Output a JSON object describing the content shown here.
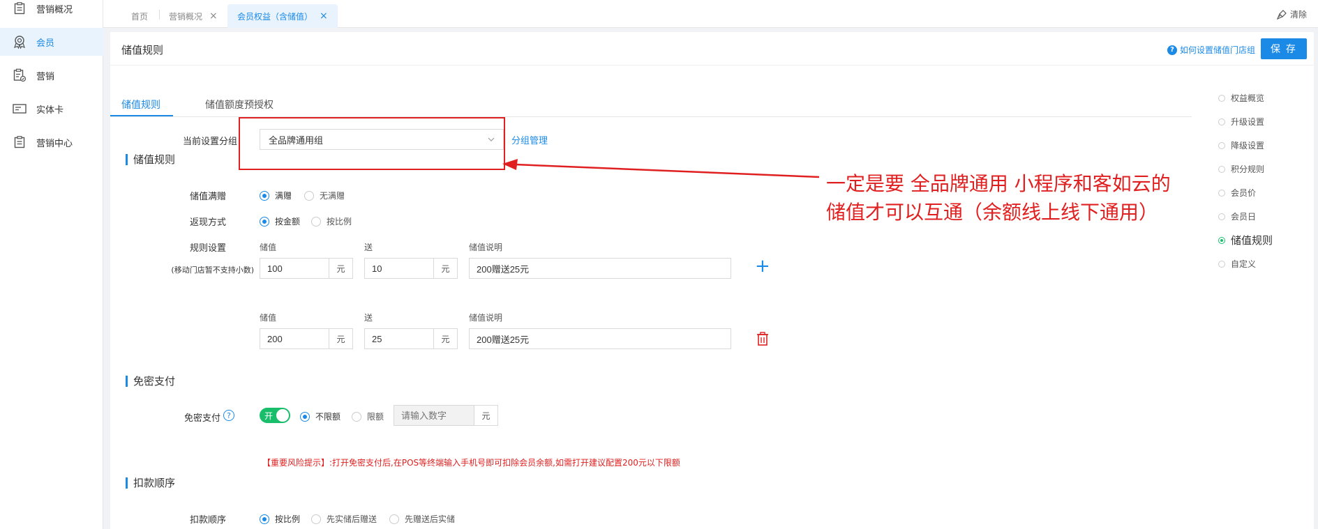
{
  "sidebar": {
    "items": [
      {
        "label": "营销概况",
        "icon": "clipboard-icon"
      },
      {
        "label": "会员",
        "icon": "member-badge-icon",
        "active": true
      },
      {
        "label": "营销",
        "icon": "marketing-clipboard-icon"
      },
      {
        "label": "实体卡",
        "icon": "card-icon"
      },
      {
        "label": "营销中心",
        "icon": "clipboard-icon"
      }
    ]
  },
  "tabbar": {
    "tabs": [
      {
        "label": "首页"
      },
      {
        "label": "营销概况"
      },
      {
        "label": "会员权益（含储值）",
        "active": true
      }
    ],
    "close_glyph": "×",
    "clear_label": "清除"
  },
  "panel": {
    "title": "储值规则",
    "help_link": "如何设置储值门店组",
    "help_icon_glyph": "?",
    "save_label": "保 存"
  },
  "subtabs": [
    {
      "label": "储值规则",
      "active": true
    },
    {
      "label": "储值额度预授权"
    }
  ],
  "group": {
    "label": "当前设置分组",
    "value": "全品牌通用组",
    "manage_link": "分组管理"
  },
  "section_stored_value": {
    "title": "储值规则",
    "bonus": {
      "label": "储值满赠",
      "options": [
        "满赠",
        "无满赠"
      ],
      "selected": 0
    },
    "cashback": {
      "label": "返现方式",
      "options": [
        "按金额",
        "按比例"
      ],
      "selected": 0
    },
    "rule_label": "规则设置",
    "rule_note": "(移动门店暂不支持小数)",
    "col_recharge": "储值",
    "col_gift": "送",
    "col_desc": "储值说明",
    "unit": "元",
    "rules": [
      {
        "recharge": "100",
        "gift": "10",
        "desc": "200赠送25元"
      },
      {
        "recharge": "200",
        "gift": "25",
        "desc": "200赠送25元"
      }
    ],
    "add_glyph": "+"
  },
  "section_password_free": {
    "title": "免密支付",
    "label": "免密支付",
    "help_glyph": "?",
    "toggle_label": "开",
    "options": [
      "不限额",
      "限额"
    ],
    "selected": 0,
    "limit_placeholder": "请输入数字",
    "unit": "元",
    "warning": "【重要风险提示】:打开免密支付后,在POS等终端输入手机号即可扣除会员余额,如需打开建议配置200元以下限额"
  },
  "section_deduct": {
    "title": "扣款顺序",
    "label": "扣款顺序",
    "options": [
      "按比例",
      "先实储后赠送",
      "先赠送后实储"
    ],
    "selected": 0
  },
  "anchor_nav": [
    {
      "label": "权益概览"
    },
    {
      "label": "升级设置"
    },
    {
      "label": "降级设置"
    },
    {
      "label": "积分规则"
    },
    {
      "label": "会员价"
    },
    {
      "label": "会员日"
    },
    {
      "label": "储值规则",
      "active": true
    },
    {
      "label": "自定义"
    }
  ],
  "annotation": {
    "line1": "一定是要  全品牌通用   小程序和客如云的",
    "line2": "储值才可以互通（余额线上线下通用）",
    "color": "#e02020"
  },
  "colors": {
    "accent": "#1b8ae6",
    "toggle_on": "#19be6b",
    "danger": "#e02020"
  }
}
